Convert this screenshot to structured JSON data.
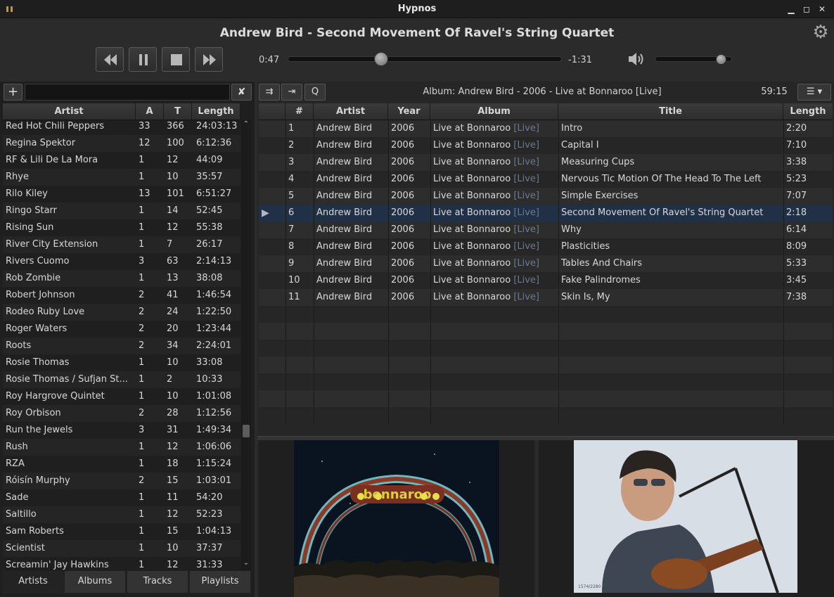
{
  "window": {
    "title": "Hypnos"
  },
  "now_playing": {
    "title": "Andrew Bird - Second Movement Of Ravel's String Quartet"
  },
  "transport": {
    "elapsed": "0:47",
    "remaining": "-1:31",
    "progress_fraction": 0.34,
    "volume_fraction": 0.86
  },
  "library": {
    "search_value": "",
    "add_label": "+",
    "clear_label": "✘",
    "columns": [
      "Artist",
      "A",
      "T",
      "Length"
    ],
    "rows": [
      {
        "artist": "Red Hot Chili Peppers",
        "a": "33",
        "t": "366",
        "length": "24:03:13"
      },
      {
        "artist": "Regina Spektor",
        "a": "12",
        "t": "100",
        "length": "6:12:36"
      },
      {
        "artist": "RF & Lili De La Mora",
        "a": "1",
        "t": "12",
        "length": "44:09"
      },
      {
        "artist": "Rhye",
        "a": "1",
        "t": "10",
        "length": "35:57"
      },
      {
        "artist": "Rilo Kiley",
        "a": "13",
        "t": "101",
        "length": "6:51:27"
      },
      {
        "artist": "Ringo Starr",
        "a": "1",
        "t": "14",
        "length": "52:45"
      },
      {
        "artist": "Rising Sun",
        "a": "1",
        "t": "12",
        "length": "55:38"
      },
      {
        "artist": "River City Extension",
        "a": "1",
        "t": "7",
        "length": "26:17"
      },
      {
        "artist": "Rivers Cuomo",
        "a": "3",
        "t": "63",
        "length": "2:14:13"
      },
      {
        "artist": "Rob Zombie",
        "a": "1",
        "t": "13",
        "length": "38:08"
      },
      {
        "artist": "Robert Johnson",
        "a": "2",
        "t": "41",
        "length": "1:46:54"
      },
      {
        "artist": "Rodeo Ruby Love",
        "a": "2",
        "t": "24",
        "length": "1:22:50"
      },
      {
        "artist": "Roger Waters",
        "a": "2",
        "t": "20",
        "length": "1:23:44"
      },
      {
        "artist": "Roots",
        "a": "2",
        "t": "34",
        "length": "2:24:01"
      },
      {
        "artist": "Rosie Thomas",
        "a": "1",
        "t": "10",
        "length": "33:08"
      },
      {
        "artist": "Rosie Thomas / Sufjan St...",
        "a": "1",
        "t": "2",
        "length": "10:33"
      },
      {
        "artist": "Roy Hargrove Quintet",
        "a": "1",
        "t": "10",
        "length": "1:01:08"
      },
      {
        "artist": "Roy Orbison",
        "a": "2",
        "t": "28",
        "length": "1:12:56"
      },
      {
        "artist": "Run the Jewels",
        "a": "3",
        "t": "31",
        "length": "1:49:34"
      },
      {
        "artist": "Rush",
        "a": "1",
        "t": "12",
        "length": "1:06:06"
      },
      {
        "artist": "RZA",
        "a": "1",
        "t": "18",
        "length": "1:15:24"
      },
      {
        "artist": "Róisín Murphy",
        "a": "2",
        "t": "15",
        "length": "1:03:01"
      },
      {
        "artist": "Sade",
        "a": "1",
        "t": "11",
        "length": "54:20"
      },
      {
        "artist": "Saltillo",
        "a": "1",
        "t": "12",
        "length": "52:23"
      },
      {
        "artist": "Sam Roberts",
        "a": "1",
        "t": "15",
        "length": "1:04:13"
      },
      {
        "artist": "Scientist",
        "a": "1",
        "t": "10",
        "length": "37:37"
      },
      {
        "artist": "Screamin' Jay Hawkins",
        "a": "1",
        "t": "12",
        "length": "31:33"
      }
    ],
    "tabs": [
      "Artists",
      "Albums",
      "Tracks",
      "Playlists"
    ]
  },
  "playlist": {
    "label": "Album: Andrew Bird - 2006 - Live at Bonnaroo [Live]",
    "length": "59:15",
    "columns": [
      "",
      "#",
      "Artist",
      "Year",
      "Album",
      "Title",
      "Length"
    ],
    "tracks": [
      {
        "num": "1",
        "artist": "Andrew Bird",
        "year": "2006",
        "album": "Live at Bonnaroo",
        "tag": "[Live]",
        "title": "Intro",
        "length": "2:20"
      },
      {
        "num": "2",
        "artist": "Andrew Bird",
        "year": "2006",
        "album": "Live at Bonnaroo",
        "tag": "[Live]",
        "title": "Capital I",
        "length": "7:10"
      },
      {
        "num": "3",
        "artist": "Andrew Bird",
        "year": "2006",
        "album": "Live at Bonnaroo",
        "tag": "[Live]",
        "title": "Measuring Cups",
        "length": "3:38"
      },
      {
        "num": "4",
        "artist": "Andrew Bird",
        "year": "2006",
        "album": "Live at Bonnaroo",
        "tag": "[Live]",
        "title": "Nervous Tic Motion Of The Head To The Left",
        "length": "5:23"
      },
      {
        "num": "5",
        "artist": "Andrew Bird",
        "year": "2006",
        "album": "Live at Bonnaroo",
        "tag": "[Live]",
        "title": "Simple Exercises",
        "length": "7:07"
      },
      {
        "num": "6",
        "artist": "Andrew Bird",
        "year": "2006",
        "album": "Live at Bonnaroo",
        "tag": "[Live]",
        "title": "Second Movement Of Ravel's String Quartet",
        "length": "2:18",
        "current": true
      },
      {
        "num": "7",
        "artist": "Andrew Bird",
        "year": "2006",
        "album": "Live at Bonnaroo",
        "tag": "[Live]",
        "title": "Why",
        "length": "6:14"
      },
      {
        "num": "8",
        "artist": "Andrew Bird",
        "year": "2006",
        "album": "Live at Bonnaroo",
        "tag": "[Live]",
        "title": "Plasticities",
        "length": "8:09"
      },
      {
        "num": "9",
        "artist": "Andrew Bird",
        "year": "2006",
        "album": "Live at Bonnaroo",
        "tag": "[Live]",
        "title": "Tables And Chairs",
        "length": "5:33"
      },
      {
        "num": "10",
        "artist": "Andrew Bird",
        "year": "2006",
        "album": "Live at Bonnaroo",
        "tag": "[Live]",
        "title": "Fake Palindromes",
        "length": "3:45"
      },
      {
        "num": "11",
        "artist": "Andrew Bird",
        "year": "2006",
        "album": "Live at Bonnaroo",
        "tag": "[Live]",
        "title": "Skin Is, My",
        "length": "7:38"
      }
    ]
  },
  "artwork": {
    "album_logo_text": "bonnaroo",
    "photo_caption": "1574/2280"
  },
  "colors": {
    "selection": "#203046",
    "live_tag": "#6a7b93",
    "accent_gold": "#c89a1c"
  }
}
